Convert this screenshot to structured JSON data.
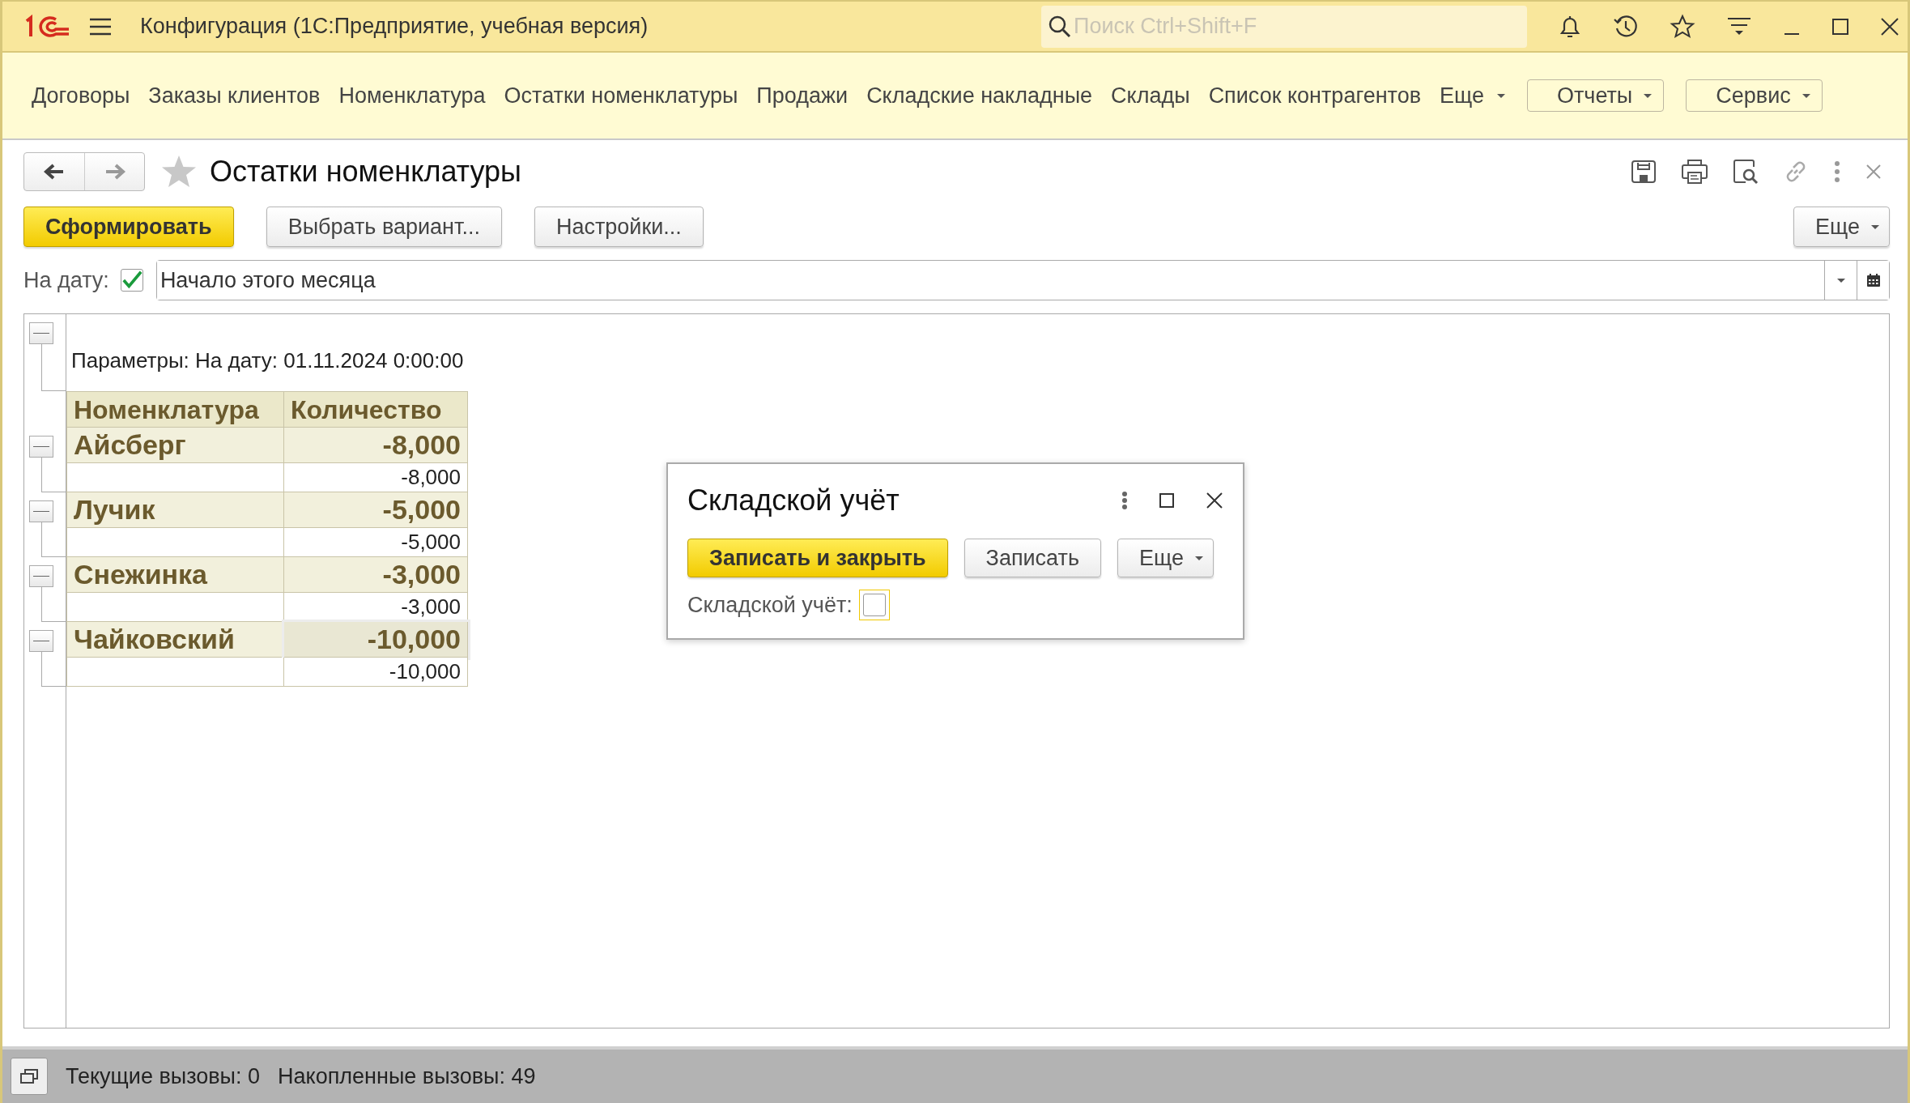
{
  "app": {
    "title": "Конфигурация  (1С:Предприятие, учебная версия)",
    "search_placeholder": "Поиск Ctrl+Shift+F"
  },
  "sections": [
    {
      "label": "Договоры",
      "kind": "link"
    },
    {
      "label": "Заказы клиентов",
      "kind": "link"
    },
    {
      "label": "Номенклатура",
      "kind": "link"
    },
    {
      "label": "Остатки номенклатуры",
      "kind": "link"
    },
    {
      "label": "Продажи",
      "kind": "link"
    },
    {
      "label": "Складские накладные",
      "kind": "link"
    },
    {
      "label": "Склады",
      "kind": "link"
    },
    {
      "label": "Список контрагентов",
      "kind": "link"
    },
    {
      "label": "Еще",
      "kind": "dropdown"
    },
    {
      "label": "Отчеты",
      "kind": "button"
    },
    {
      "label": "Сервис",
      "kind": "button"
    }
  ],
  "form": {
    "title": "Остатки номенклатуры",
    "buttons": [
      {
        "label": "Сформировать",
        "kind": "primary"
      },
      {
        "label": "Выбрать вариант...",
        "kind": "default"
      },
      {
        "label": "Настройки...",
        "kind": "default"
      }
    ],
    "more": "Еще",
    "date": {
      "label": "На дату:",
      "checked": true,
      "value": "Начало этого месяца"
    }
  },
  "report": {
    "params": "Параметры:  На дату: 01.11.2024 0:00:00",
    "columns": [
      "Номенклатура",
      "Количество"
    ],
    "groups": [
      {
        "name": "Айсберг",
        "total": "-8,000",
        "expanded": true,
        "selected": false,
        "children": [
          {
            "quantity": "-8,000"
          }
        ]
      },
      {
        "name": "Лучик",
        "total": "-5,000",
        "expanded": true,
        "selected": false,
        "children": [
          {
            "quantity": "-5,000"
          }
        ]
      },
      {
        "name": "Снежинка",
        "total": "-3,000",
        "expanded": true,
        "selected": false,
        "children": [
          {
            "quantity": "-3,000"
          }
        ]
      },
      {
        "name": "Чайковский",
        "total": "-10,000",
        "expanded": true,
        "selected": true,
        "children": [
          {
            "quantity": "-10,000"
          }
        ]
      }
    ]
  },
  "dialog": {
    "title": "Складской учёт",
    "buttons": [
      {
        "label": "Записать и закрыть",
        "kind": "primary"
      },
      {
        "label": "Записать",
        "kind": "default"
      }
    ],
    "more": "Еще",
    "field": {
      "label": "Складской учёт:",
      "checked": false
    }
  },
  "status_bar": {
    "current": "Текущие вызовы: 0",
    "accumulated": "Накопленные вызовы: 49"
  }
}
